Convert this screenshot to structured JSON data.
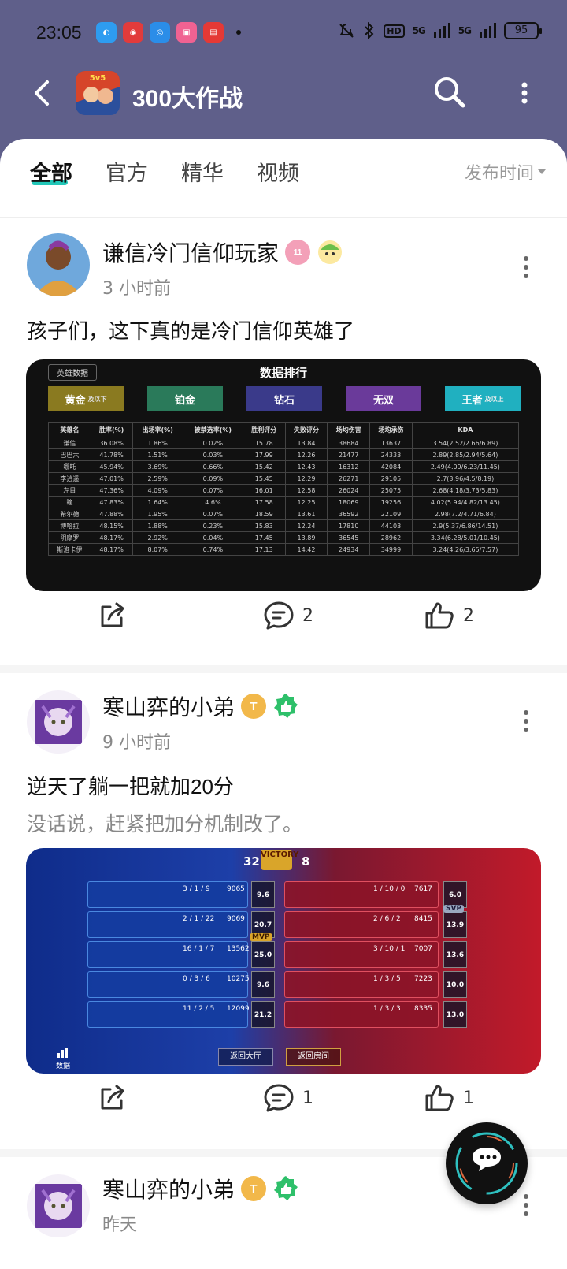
{
  "status_bar": {
    "time": "23:05",
    "battery": "95",
    "signal1": "5G",
    "signal2": "5G",
    "hd": "HD"
  },
  "header": {
    "title": "300大作战"
  },
  "tabs": [
    {
      "label": "全部"
    },
    {
      "label": "官方"
    },
    {
      "label": "精华"
    },
    {
      "label": "视频"
    }
  ],
  "sort": {
    "label": "发布时间"
  },
  "posts": [
    {
      "author": "谦信冷门信仰玩家",
      "badge_text": "11",
      "time": "3 小时前",
      "title": "孩子们，这下真的是冷门信仰英雄了",
      "comments": "2",
      "likes": "2",
      "image": {
        "header": "数据排行",
        "back_label": "英雄数据",
        "tiers": [
          "黄金",
          "铂金",
          "钻石",
          "无双",
          "王者"
        ],
        "tier_subs": [
          "及以下",
          "",
          "",
          "",
          "及以上"
        ],
        "columns": [
          "英雄名",
          "胜率(%)",
          "出场率(%)",
          "被禁选率(%)",
          "胜利评分",
          "失败评分",
          "场均伤害",
          "场均承伤",
          "KDA"
        ],
        "rows": [
          [
            "谦信",
            "36.08%",
            "1.86%",
            "0.02%",
            "15.78",
            "13.84",
            "38684",
            "13637",
            "3.54(2.52/2.66/6.89)"
          ],
          [
            "巴巴六",
            "41.78%",
            "1.51%",
            "0.03%",
            "17.99",
            "12.26",
            "21477",
            "24333",
            "2.89(2.85/2.94/5.64)"
          ],
          [
            "哪吒",
            "45.94%",
            "3.69%",
            "0.66%",
            "15.42",
            "12.43",
            "16312",
            "42084",
            "2.49(4.09/6.23/11.45)"
          ],
          [
            "李逍遥",
            "47.01%",
            "2.59%",
            "0.09%",
            "15.45",
            "12.29",
            "26271",
            "29105",
            "2.7(3.96/4.5/8.19)"
          ],
          [
            "左目",
            "47.36%",
            "4.09%",
            "0.07%",
            "16.01",
            "12.58",
            "26024",
            "25075",
            "2.68(4.18/3.73/5.83)"
          ],
          [
            "瞳",
            "47.83%",
            "1.64%",
            "4.6%",
            "17.58",
            "12.25",
            "18069",
            "19256",
            "4.02(5.94/4.82/13.45)"
          ],
          [
            "希尔德",
            "47.88%",
            "1.95%",
            "0.07%",
            "18.59",
            "13.61",
            "36592",
            "22109",
            "2.98(7.2/4.71/6.84)"
          ],
          [
            "博哈拉",
            "48.15%",
            "1.88%",
            "0.23%",
            "15.83",
            "12.24",
            "17810",
            "44103",
            "2.9(5.37/6.86/14.51)"
          ],
          [
            "阴摩罗",
            "48.17%",
            "2.92%",
            "0.04%",
            "17.45",
            "13.89",
            "36545",
            "28962",
            "3.34(6.28/5.01/10.45)"
          ],
          [
            "斯洛卡伊",
            "48.17%",
            "8.07%",
            "0.74%",
            "17.13",
            "14.42",
            "24934",
            "34999",
            "3.24(4.26/3.65/7.57)"
          ]
        ]
      }
    },
    {
      "author": "寒山弈的小弟",
      "badge_text": "T",
      "time": "9 小时前",
      "title": "逆天了躺一把就加20分",
      "body": "没话说，赶紧把加分机制改了。",
      "comments": "1",
      "likes": "1",
      "image": {
        "score_left": "32",
        "score_right": "8",
        "victory": "VICTORY",
        "left_kda": [
          "3 / 1 / 9",
          "2 / 1 / 22",
          "16 / 1 / 7",
          "0 / 3 / 6",
          "11 / 2 / 5"
        ],
        "left_dmg": [
          "9065",
          "9069",
          "13562",
          "10275",
          "12099"
        ],
        "left_scores": [
          "9.6",
          "20.7",
          "25.0",
          "9.6",
          "21.2"
        ],
        "right_kda": [
          "1 / 10 / 0",
          "2 / 6 / 2",
          "3 / 10 / 1",
          "1 / 3 / 5",
          "1 / 3 / 3"
        ],
        "right_dmg": [
          "7617",
          "8415",
          "7007",
          "7223",
          "8335"
        ],
        "right_scores": [
          "6.0",
          "13.9",
          "13.6",
          "10.0",
          "13.0"
        ],
        "mvp": "MVP",
        "svp": "SVP",
        "btn_lobby": "返回大厅",
        "btn_room": "返回房间",
        "data_label": "数据"
      }
    },
    {
      "author": "寒山弈的小弟",
      "badge_text": "T",
      "time": "昨天"
    }
  ]
}
